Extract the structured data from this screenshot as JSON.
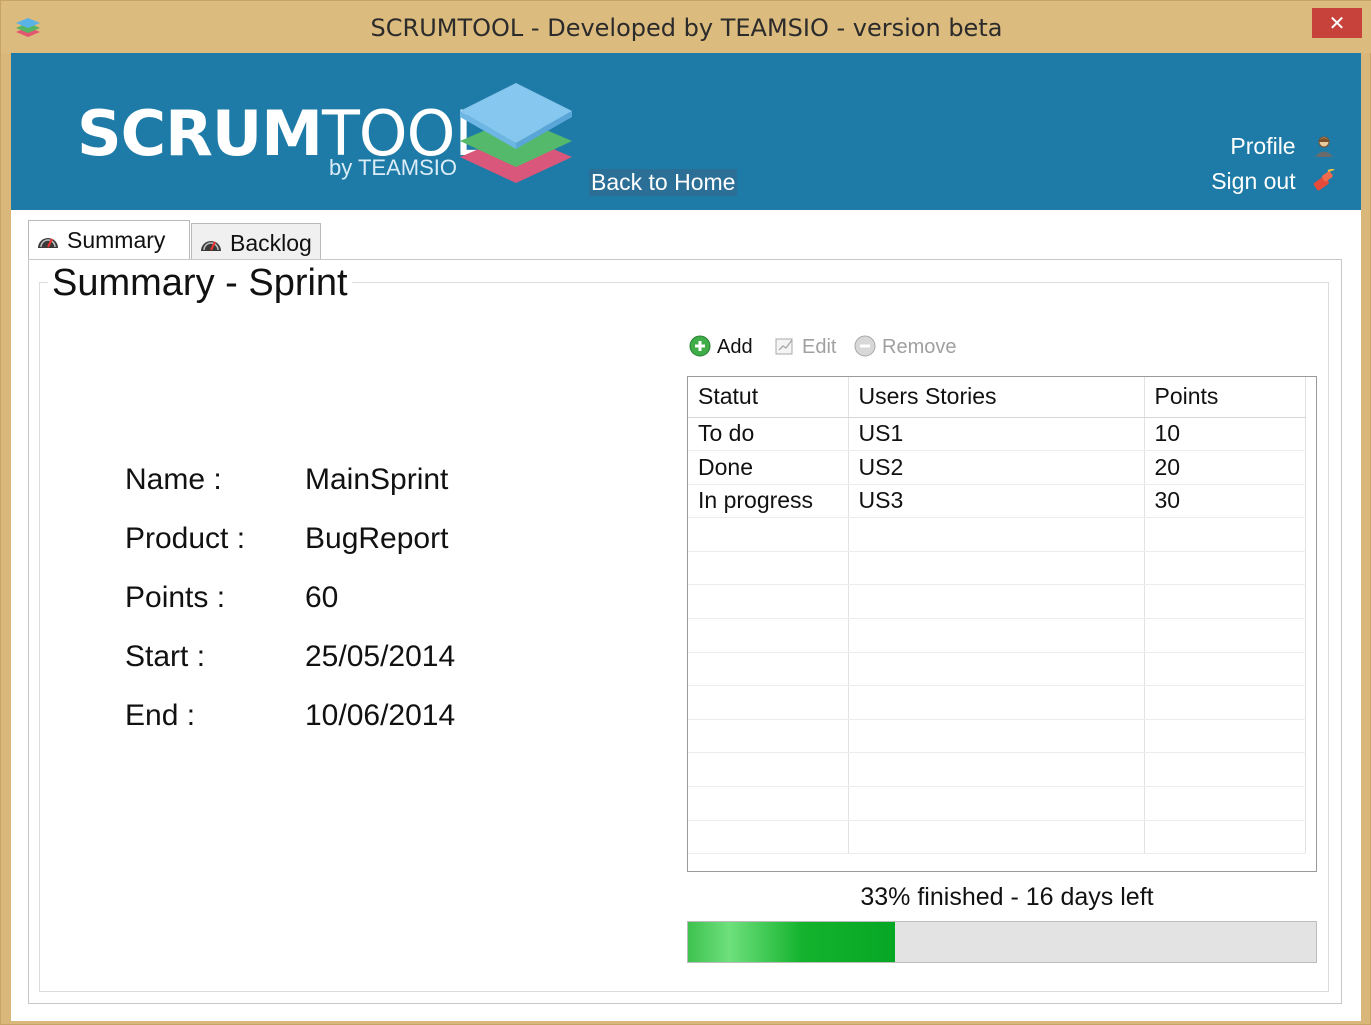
{
  "window": {
    "title": "SCRUMTOOL - Developed by TEAMSIO - version beta",
    "close_glyph": "✕"
  },
  "header": {
    "logo_bold": "SCRUM",
    "logo_light": "TOOL",
    "logo_by": "by TEAMSIO",
    "back_home": "Back to Home",
    "profile": "Profile",
    "sign_out": "Sign out",
    "background_color": "#1e7ba7"
  },
  "tabs": [
    {
      "label": "Summary",
      "icon": "dashboard-gauge-icon",
      "active": true
    },
    {
      "label": "Backlog",
      "icon": "dashboard-gauge-icon",
      "active": false
    }
  ],
  "summary": {
    "title": "Summary - Sprint",
    "fields": [
      {
        "label": "Name :",
        "value": "MainSprint"
      },
      {
        "label": "Product :",
        "value": "BugReport"
      },
      {
        "label": "Points :",
        "value": "60"
      },
      {
        "label": "Start :",
        "value": "25/05/2014"
      },
      {
        "label": "End :",
        "value": "10/06/2014"
      }
    ]
  },
  "toolbar": {
    "add": "Add",
    "edit": "Edit",
    "remove": "Remove"
  },
  "stories_table": {
    "columns": [
      "Statut",
      "Users Stories",
      "Points"
    ],
    "rows": [
      [
        "To do",
        "US1",
        "10"
      ],
      [
        "Done",
        "US2",
        "20"
      ],
      [
        "In progress",
        "US3",
        "30"
      ]
    ]
  },
  "progress": {
    "label": "33% finished - 16 days left",
    "fraction": 0.33,
    "fill_color": "#14b32e"
  }
}
